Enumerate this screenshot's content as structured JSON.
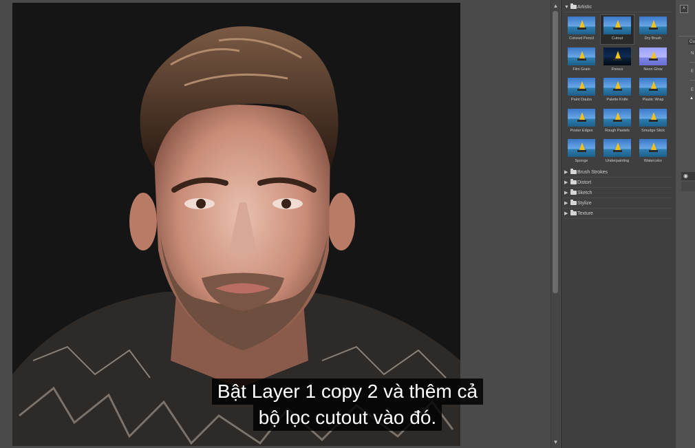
{
  "gallery": {
    "artistic_label": "Artistic",
    "filters": [
      {
        "label": "Colored Pencil",
        "style": "std"
      },
      {
        "label": "Cutout",
        "style": "std",
        "selected": true
      },
      {
        "label": "Dry Brush",
        "style": "std"
      },
      {
        "label": "Film Grain",
        "style": "std"
      },
      {
        "label": "Fresco",
        "style": "dark"
      },
      {
        "label": "Neon Glow",
        "style": "neon"
      },
      {
        "label": "Paint Daubs",
        "style": "std"
      },
      {
        "label": "Palette Knife",
        "style": "std"
      },
      {
        "label": "Plastic Wrap",
        "style": "std"
      },
      {
        "label": "Poster Edges",
        "style": "std"
      },
      {
        "label": "Rough Pastels",
        "style": "std"
      },
      {
        "label": "Smudge Stick",
        "style": "std"
      },
      {
        "label": "Sponge",
        "style": "std"
      },
      {
        "label": "Underpainting",
        "style": "std"
      },
      {
        "label": "Watercolor",
        "style": "std"
      }
    ],
    "folders": [
      "Brush Strokes",
      "Distort",
      "Sketch",
      "Stylize",
      "Texture"
    ]
  },
  "right_panel": {
    "tab_label": "Cut",
    "row_labels": [
      "N",
      "E",
      "E"
    ]
  },
  "subtitle": {
    "line1": "Bật Layer 1 copy 2 và thêm cả",
    "line2": "bộ lọc cutout vào đó."
  },
  "colors": {
    "canvas_bg": "#151515",
    "panel_bg": "#3f3f3f",
    "subtitle_bg": "#000000"
  }
}
